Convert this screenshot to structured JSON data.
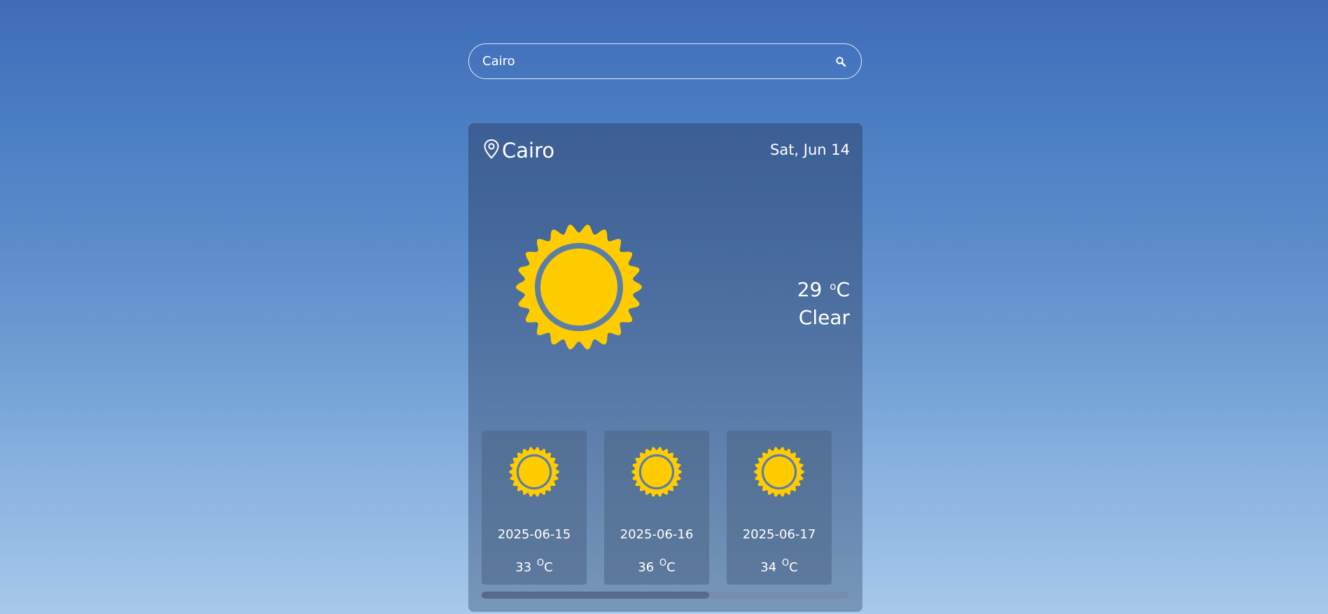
{
  "search": {
    "value": "Cairo",
    "icon": "search-icon"
  },
  "current": {
    "location_icon": "map-pin-icon",
    "city": "Cairo",
    "date": "Sat, Jun 14",
    "weather_icon": "sun-icon",
    "temperature": "29",
    "degree_symbol": "o",
    "unit": "C",
    "condition": "Clear"
  },
  "forecast": [
    {
      "icon": "sun-icon",
      "date": "2025-06-15",
      "temperature": "33",
      "degree_symbol": "O",
      "unit": "C"
    },
    {
      "icon": "sun-icon",
      "date": "2025-06-16",
      "temperature": "36",
      "degree_symbol": "O",
      "unit": "C"
    },
    {
      "icon": "sun-icon",
      "date": "2025-06-17",
      "temperature": "34",
      "degree_symbol": "O",
      "unit": "C"
    }
  ],
  "colors": {
    "sun": "#ffcc00",
    "sun_ring": "#5b7ea7",
    "text": "#ffffff"
  }
}
